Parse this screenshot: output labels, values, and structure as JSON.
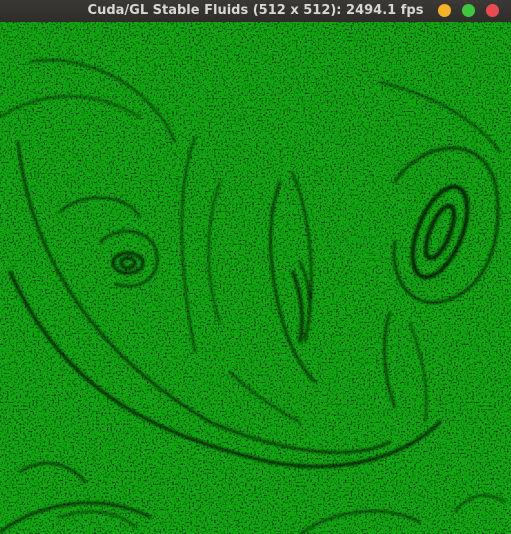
{
  "window": {
    "title": "Cuda/GL Stable Fluids (512 x 512): 2494.1 fps",
    "buttons": {
      "minimize": {
        "icon": "minimize-icon",
        "color": "#f4b227"
      },
      "maximize": {
        "icon": "maximize-icon",
        "color": "#3fc63f"
      },
      "close": {
        "icon": "close-icon",
        "color": "#ea4a4f"
      }
    }
  },
  "simulation": {
    "fluid_color": "#12a812",
    "particle_color": "#000000"
  }
}
